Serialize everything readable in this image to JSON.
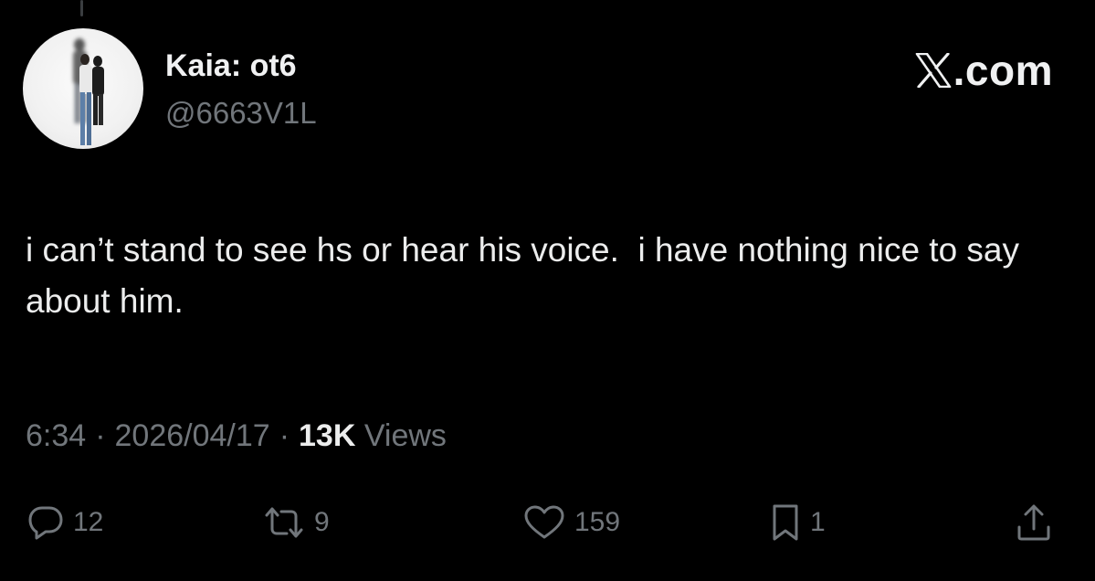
{
  "user": {
    "display_name": "Kaia: ot6",
    "handle": "@6663V1L",
    "avatar_icon": "profile-photo"
  },
  "brand": {
    "text": ".com",
    "logo_icon": "x-logo-icon"
  },
  "tweet": {
    "text": "i can’t stand to see hs or hear his voice.  i have nothing nice to say about him."
  },
  "meta": {
    "time": "6:34",
    "separator": "·",
    "date": "2026/04/17",
    "views_count": "13K",
    "views_label": "Views"
  },
  "actions": {
    "reply": {
      "icon": "reply-icon",
      "count": "12"
    },
    "repost": {
      "icon": "repost-icon",
      "count": "9"
    },
    "like": {
      "icon": "heart-icon",
      "count": "159"
    },
    "bookmark": {
      "icon": "bookmark-icon",
      "count": "1"
    },
    "share": {
      "icon": "share-icon"
    }
  },
  "colors": {
    "background": "#000000",
    "primary_text": "#e7e9ea",
    "secondary_text": "#71767b"
  }
}
